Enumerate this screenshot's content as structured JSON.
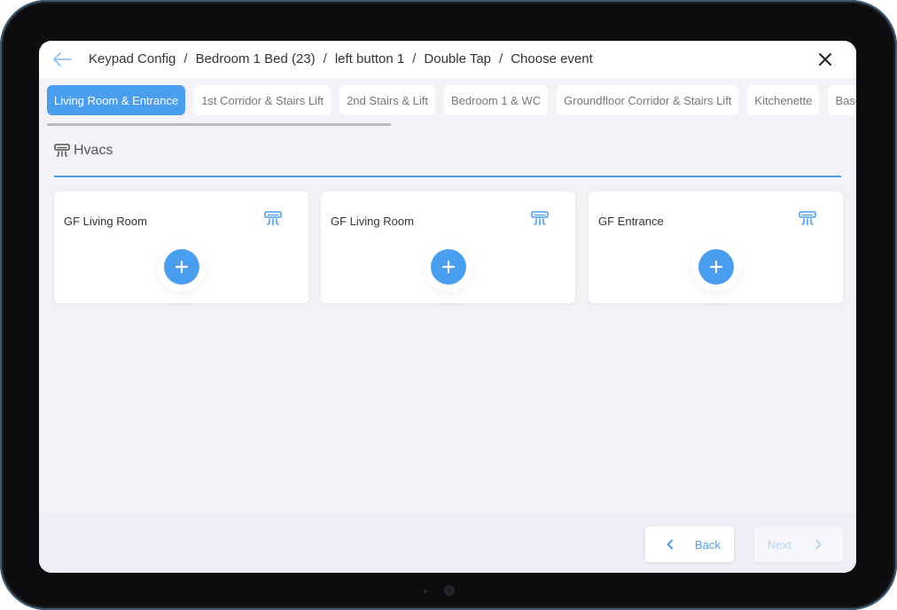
{
  "header": {
    "breadcrumb": [
      "Keypad Config",
      "Bedroom 1 Bed (23)",
      "left button 1",
      "Double Tap",
      "Choose event"
    ],
    "back_icon": "arrow-left-icon",
    "close_icon": "close-icon"
  },
  "tabs": [
    {
      "label": "Living Room & Entrance",
      "active": true
    },
    {
      "label": "1st Corridor & Stairs Lift",
      "active": false
    },
    {
      "label": "2nd Stairs & Lift",
      "active": false
    },
    {
      "label": "Bedroom 1 & WC",
      "active": false
    },
    {
      "label": "Groundfloor Corridor & Stairs Lift",
      "active": false
    },
    {
      "label": "Kitchenette",
      "active": false
    },
    {
      "label": "Base",
      "active": false
    }
  ],
  "section": {
    "title": "Hvacs",
    "icon": "hvac-icon"
  },
  "cards": [
    {
      "title": "GF Living Room",
      "icon": "hvac-icon",
      "action_icon": "plus-icon"
    },
    {
      "title": "GF Living Room",
      "icon": "hvac-icon",
      "action_icon": "plus-icon"
    },
    {
      "title": "GF Entrance",
      "icon": "hvac-icon",
      "action_icon": "plus-icon"
    }
  ],
  "footer": {
    "back_label": "Back",
    "next_label": "Next"
  },
  "colors": {
    "accent": "#4a9ef0",
    "background": "#f3f3f7",
    "device_frame": "#0d0d0f"
  }
}
